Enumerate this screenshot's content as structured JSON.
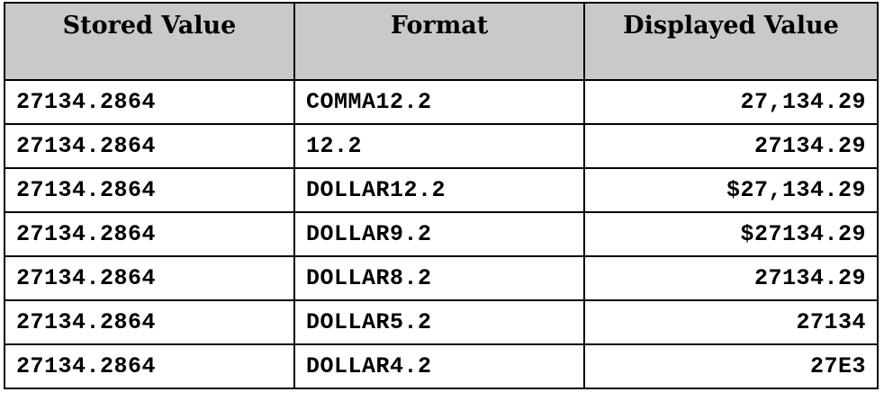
{
  "table": {
    "headers": [
      "Stored Value",
      "Format",
      "Displayed Value"
    ],
    "rows": [
      [
        "27134.2864",
        "COMMA12.2",
        "27,134.29"
      ],
      [
        "27134.2864",
        "12.2",
        "27134.29"
      ],
      [
        "27134.2864",
        "DOLLAR12.2",
        "$27,134.29"
      ],
      [
        "27134.2864",
        "DOLLAR9.2",
        "$27134.29"
      ],
      [
        "27134.2864",
        "DOLLAR8.2",
        "27134.29"
      ],
      [
        "27134.2864",
        "DOLLAR5.2",
        "27134"
      ],
      [
        "27134.2864",
        "DOLLAR4.2",
        "27E3"
      ]
    ]
  },
  "colors": {
    "header_bg": "#c9c9c9",
    "border": "#000000",
    "text": "#000000"
  }
}
